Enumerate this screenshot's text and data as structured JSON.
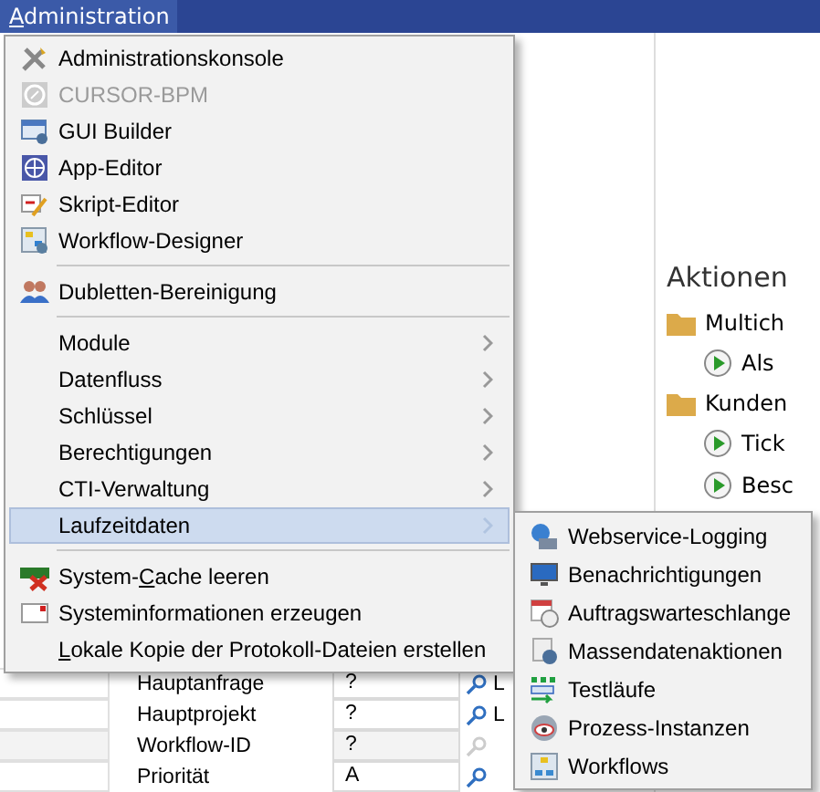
{
  "menubar": {
    "menu": {
      "key": "A",
      "after": "dministration"
    }
  },
  "menu": {
    "items": [
      {
        "kind": "item",
        "label": "Administrationskonsole",
        "disabled": false,
        "highlighted": false
      },
      {
        "kind": "item",
        "label": "CURSOR-BPM",
        "disabled": true,
        "highlighted": false
      },
      {
        "kind": "item",
        "label": "GUI Builder",
        "disabled": false,
        "highlighted": false
      },
      {
        "kind": "item",
        "label": "App-Editor",
        "disabled": false,
        "highlighted": false
      },
      {
        "kind": "item",
        "label": "Skript-Editor",
        "disabled": false,
        "highlighted": false
      },
      {
        "kind": "item",
        "label": "Workflow-Designer",
        "disabled": false,
        "highlighted": false
      },
      {
        "kind": "separator"
      },
      {
        "kind": "item",
        "label": "Dubletten-Bereinigung",
        "disabled": false,
        "highlighted": false
      },
      {
        "kind": "separator"
      },
      {
        "kind": "submenu",
        "label": "Module",
        "disabled": false,
        "highlighted": false
      },
      {
        "kind": "submenu",
        "label": "Datenfluss",
        "disabled": false,
        "highlighted": false
      },
      {
        "kind": "submenu",
        "label": "Schlüssel",
        "disabled": false,
        "highlighted": false
      },
      {
        "kind": "submenu",
        "label": "Berechtigungen",
        "disabled": false,
        "highlighted": false
      },
      {
        "kind": "submenu",
        "label": "CTI-Verwaltung",
        "disabled": false,
        "highlighted": false
      },
      {
        "kind": "submenu",
        "label": "Laufzeitdaten",
        "disabled": false,
        "highlighted": true
      },
      {
        "kind": "separator"
      },
      {
        "kind": "item",
        "label": {
          "before": "System-",
          "key": "C",
          "after": "ache leeren"
        },
        "disabled": false,
        "highlighted": false
      },
      {
        "kind": "item",
        "label": "Systeminformationen erzeugen",
        "disabled": false,
        "highlighted": false
      },
      {
        "kind": "item",
        "label": {
          "key": "L",
          "after": "okale Kopie der Protokoll-Dateien erstellen"
        },
        "disabled": false,
        "highlighted": false
      }
    ]
  },
  "submenu": {
    "items": [
      "Webservice-Logging",
      "Benachrichtigungen",
      "Auftragswarteschlange",
      "Massendatenaktionen",
      "Testläufe",
      "Prozess-Instanzen",
      "Workflows"
    ]
  },
  "actions_panel": {
    "title": "Aktionen",
    "items": [
      {
        "kind": "folder",
        "label": "Multich"
      },
      {
        "kind": "action",
        "label": "Als"
      },
      {
        "kind": "folder",
        "label": "Kunden"
      },
      {
        "kind": "action",
        "label": "Tick"
      },
      {
        "kind": "action",
        "label": "Besc"
      }
    ]
  },
  "form": {
    "rows": [
      {
        "label": "Hauptanfrage",
        "value": "?",
        "lookup_enabled": true,
        "extra": "L"
      },
      {
        "label": "Hauptprojekt",
        "value": "?",
        "lookup_enabled": true,
        "extra": "L"
      },
      {
        "label": "Workflow-ID",
        "value": "?",
        "lookup_enabled": false
      },
      {
        "label": "Priorität",
        "value": "A",
        "lookup_enabled": true
      }
    ]
  }
}
